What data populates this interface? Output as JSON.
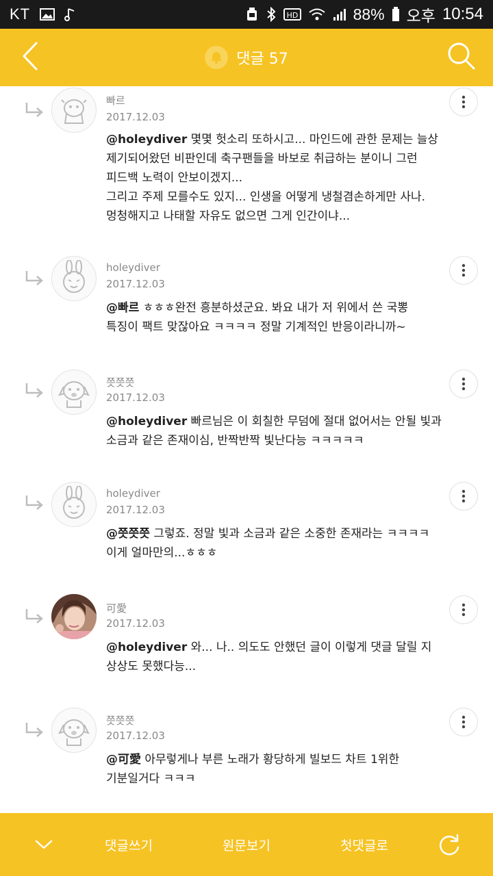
{
  "status_bar": {
    "carrier": "KT",
    "battery_percent": "88%",
    "ampm": "오후",
    "time": "10:54",
    "icons": [
      "image-icon",
      "music-note-icon",
      "android-icon",
      "bluetooth-icon",
      "hd-icon",
      "wifi-icon",
      "signal-icon",
      "battery-icon"
    ]
  },
  "header": {
    "title": "댓글 57",
    "icons": {
      "back": "back-chevron-icon",
      "bell": "bell-icon",
      "search": "search-icon"
    }
  },
  "comments": [
    {
      "author": "빠르",
      "date": "2017.12.03",
      "avatar": "cartoon-character-avatar",
      "mention": "@holeydiver",
      "lines": [
        " 몇몇 헛소리 또하시고... 마인드에 관한 문제는 늘상",
        "제기되어왔던 비판인데 축구팬들을 바보로 취급하는 분이니 그런",
        "피드백 노력이 안보이겠지...",
        "그리고 주제 모를수도 있지... 인생을 어떻게 냉철겸손하게만 사나.",
        "멍청해지고 나태할 자유도 없으면 그게 인간이냐..."
      ]
    },
    {
      "author": "holeydiver",
      "date": "2017.12.03",
      "avatar": "bunny-avatar",
      "mention": "@빠르",
      "lines": [
        " ㅎㅎㅎ완전 흥분하셨군요. 봐요 내가 저 위에서 쓴 국뽕",
        "특징이 팩트 맞잖아요 ㅋㅋㅋㅋ 정말 기계적인 반응이라니까~"
      ]
    },
    {
      "author": "쯧쯧쯧",
      "date": "2017.12.03",
      "avatar": "dog-avatar",
      "mention": "@holeydiver",
      "lines": [
        " 빠르님은 이 회칠한 무덤에 절대 없어서는 안될 빛과",
        "소금과 같은 존재이심, 반짝반짝 빛난다능 ㅋㅋㅋㅋㅋ"
      ]
    },
    {
      "author": "holeydiver",
      "date": "2017.12.03",
      "avatar": "bunny-avatar",
      "mention": "@쯧쯧쯧",
      "lines": [
        " 그렇죠. 정말 빛과 소금과 같은 소중한 존재라는 ㅋㅋㅋㅋ",
        "이게 얼마만의...ㅎㅎㅎ"
      ]
    },
    {
      "author": "可愛",
      "date": "2017.12.03",
      "avatar": "photo-avatar",
      "mention": "@holeydiver",
      "lines": [
        " 와... 나.. 의도도 안했던 글이 이렇게 댓글 달릴 지",
        "상상도 못했다능..."
      ]
    },
    {
      "author": "쯧쯧쯧",
      "date": "2017.12.03",
      "avatar": "dog-avatar",
      "mention": "@可愛",
      "lines": [
        " 아무렇게나 부른 노래가 황당하게 빌보드 차트 1위한",
        "기분일거다 ㅋㅋㅋ"
      ]
    }
  ],
  "bottom_bar": {
    "write_comment": "댓글쓰기",
    "view_original": "원문보기",
    "first_comment": "첫댓글로",
    "icons": {
      "collapse": "chevron-down-icon",
      "refresh": "refresh-icon"
    }
  },
  "colors": {
    "accent": "#f6c324",
    "status_bar": "#1a1a1a",
    "meta_text": "#888888",
    "body_text": "#222222"
  }
}
